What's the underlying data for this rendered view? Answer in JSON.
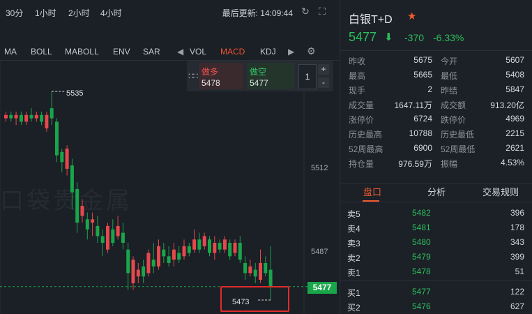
{
  "toolbar": {
    "timeframes": [
      "30分",
      "1小时",
      "2小时",
      "4小时"
    ],
    "last_update_label": "最后更新: 14:09:44"
  },
  "indicators": {
    "left_items": [
      "MA",
      "BOLL",
      "MABOLL",
      "ENV",
      "SAR"
    ],
    "right_items": [
      "VOL",
      "MACD",
      "KDJ"
    ],
    "active": "MACD"
  },
  "order_panel": {
    "buy_label": "做多",
    "buy_price": "5478",
    "sell_label": "做空",
    "sell_price": "5477",
    "quantity": "1",
    "plus": "+",
    "minus": "-"
  },
  "chart": {
    "watermark": "口袋贵金属",
    "price_labels": [
      "5512",
      "5487"
    ],
    "current_price": "5477",
    "high_marker": "5535",
    "low_marker": "5473"
  },
  "chart_data": {
    "type": "candlestick",
    "title": "",
    "y_ticks": [
      5512,
      5487
    ],
    "current": 5477,
    "high": 5535,
    "low": 5473,
    "candles": [
      {
        "o": 5527,
        "c": 5528,
        "h": 5529,
        "l": 5526
      },
      {
        "o": 5528,
        "c": 5527,
        "h": 5529,
        "l": 5526
      },
      {
        "o": 5527,
        "c": 5528,
        "h": 5529,
        "l": 5525
      },
      {
        "o": 5528,
        "c": 5526,
        "h": 5529,
        "l": 5525
      },
      {
        "o": 5526,
        "c": 5528,
        "h": 5529,
        "l": 5525
      },
      {
        "o": 5528,
        "c": 5527,
        "h": 5530,
        "l": 5526
      },
      {
        "o": 5527,
        "c": 5528,
        "h": 5529,
        "l": 5526
      },
      {
        "o": 5528,
        "c": 5526,
        "h": 5529,
        "l": 5525
      },
      {
        "o": 5524,
        "c": 5528,
        "h": 5529,
        "l": 5523
      },
      {
        "o": 5530,
        "c": 5527,
        "h": 5535,
        "l": 5525
      },
      {
        "o": 5526,
        "c": 5516,
        "h": 5527,
        "l": 5514
      },
      {
        "o": 5517,
        "c": 5514,
        "h": 5518,
        "l": 5511
      },
      {
        "o": 5512,
        "c": 5518,
        "h": 5519,
        "l": 5510
      },
      {
        "o": 5513,
        "c": 5505,
        "h": 5515,
        "l": 5500
      },
      {
        "o": 5506,
        "c": 5496,
        "h": 5508,
        "l": 5493
      },
      {
        "o": 5498,
        "c": 5501,
        "h": 5503,
        "l": 5496
      },
      {
        "o": 5497,
        "c": 5494,
        "h": 5499,
        "l": 5491
      },
      {
        "o": 5496,
        "c": 5497,
        "h": 5499,
        "l": 5492
      },
      {
        "o": 5495,
        "c": 5492,
        "h": 5498,
        "l": 5490
      },
      {
        "o": 5492,
        "c": 5490,
        "h": 5494,
        "l": 5486
      },
      {
        "o": 5488,
        "c": 5495,
        "h": 5496,
        "l": 5487
      },
      {
        "o": 5494,
        "c": 5490,
        "h": 5497,
        "l": 5489
      },
      {
        "o": 5492,
        "c": 5495,
        "h": 5498,
        "l": 5491
      },
      {
        "o": 5493,
        "c": 5490,
        "h": 5496,
        "l": 5488
      },
      {
        "o": 5488,
        "c": 5481,
        "h": 5490,
        "l": 5476
      },
      {
        "o": 5478,
        "c": 5485,
        "h": 5486,
        "l": 5476
      },
      {
        "o": 5480,
        "c": 5482,
        "h": 5484,
        "l": 5478
      },
      {
        "o": 5483,
        "c": 5480,
        "h": 5485,
        "l": 5478
      },
      {
        "o": 5481,
        "c": 5487,
        "h": 5488,
        "l": 5480
      },
      {
        "o": 5485,
        "c": 5483,
        "h": 5490,
        "l": 5481
      },
      {
        "o": 5483,
        "c": 5489,
        "h": 5491,
        "l": 5482
      },
      {
        "o": 5488,
        "c": 5486,
        "h": 5490,
        "l": 5484
      },
      {
        "o": 5486,
        "c": 5484,
        "h": 5489,
        "l": 5483
      },
      {
        "o": 5485,
        "c": 5488,
        "h": 5490,
        "l": 5483
      },
      {
        "o": 5487,
        "c": 5485,
        "h": 5489,
        "l": 5484
      },
      {
        "o": 5486,
        "c": 5489,
        "h": 5491,
        "l": 5485
      },
      {
        "o": 5489,
        "c": 5487,
        "h": 5490,
        "l": 5486
      },
      {
        "o": 5488,
        "c": 5491,
        "h": 5494,
        "l": 5487
      },
      {
        "o": 5491,
        "c": 5488,
        "h": 5493,
        "l": 5487
      },
      {
        "o": 5489,
        "c": 5492,
        "h": 5493,
        "l": 5488
      },
      {
        "o": 5491,
        "c": 5487,
        "h": 5492,
        "l": 5486
      },
      {
        "o": 5487,
        "c": 5490,
        "h": 5492,
        "l": 5485
      },
      {
        "o": 5490,
        "c": 5488,
        "h": 5491,
        "l": 5487
      },
      {
        "o": 5488,
        "c": 5491,
        "h": 5492,
        "l": 5487
      },
      {
        "o": 5490,
        "c": 5486,
        "h": 5491,
        "l": 5485
      },
      {
        "o": 5487,
        "c": 5490,
        "h": 5491,
        "l": 5486
      },
      {
        "o": 5490,
        "c": 5485,
        "h": 5492,
        "l": 5484
      },
      {
        "o": 5484,
        "c": 5481,
        "h": 5486,
        "l": 5479
      },
      {
        "o": 5481,
        "c": 5483,
        "h": 5485,
        "l": 5480
      },
      {
        "o": 5482,
        "c": 5480,
        "h": 5484,
        "l": 5478
      },
      {
        "o": 5479,
        "c": 5484,
        "h": 5488,
        "l": 5478
      },
      {
        "o": 5484,
        "c": 5481,
        "h": 5486,
        "l": 5480
      },
      {
        "o": 5482,
        "c": 5477,
        "h": 5489,
        "l": 5473
      }
    ]
  },
  "quote": {
    "title": "白银T+D",
    "price": "5477",
    "change": "-370",
    "change_pct": "-6.33%",
    "stats": [
      {
        "l_name": "昨收",
        "l_val": "5675",
        "r_name": "今开",
        "r_val": "5607"
      },
      {
        "l_name": "最高",
        "l_val": "5665",
        "r_name": "最低",
        "r_val": "5408"
      },
      {
        "l_name": "现手",
        "l_val": "2",
        "r_name": "昨结",
        "r_val": "5847"
      },
      {
        "l_name": "成交量",
        "l_val": "1647.11万",
        "r_name": "成交额",
        "r_val": "913.20亿"
      },
      {
        "l_name": "涨停价",
        "l_val": "6724",
        "r_name": "跌停价",
        "r_val": "4969"
      },
      {
        "l_name": "历史最高",
        "l_val": "10788",
        "r_name": "历史最低",
        "r_val": "2215"
      },
      {
        "l_name": "52周最高",
        "l_val": "6900",
        "r_name": "52周最低",
        "r_val": "2621"
      },
      {
        "l_name": "持仓量",
        "l_val": "976.59万",
        "r_name": "振幅",
        "r_val": "4.53%"
      }
    ],
    "tabs": [
      "盘口",
      "分析",
      "交易规则"
    ],
    "order_book": [
      {
        "label": "卖5",
        "price": "5482",
        "vol": "396"
      },
      {
        "label": "卖4",
        "price": "5481",
        "vol": "178"
      },
      {
        "label": "卖3",
        "price": "5480",
        "vol": "343"
      },
      {
        "label": "卖2",
        "price": "5479",
        "vol": "399"
      },
      {
        "label": "卖1",
        "price": "5478",
        "vol": "51"
      },
      {
        "label": "买1",
        "price": "5477",
        "vol": "122"
      },
      {
        "label": "买2",
        "price": "5476",
        "vol": "627"
      }
    ]
  },
  "colors": {
    "up": "#e5484d",
    "down": "#19a54a",
    "accent": "#f05b2f"
  }
}
